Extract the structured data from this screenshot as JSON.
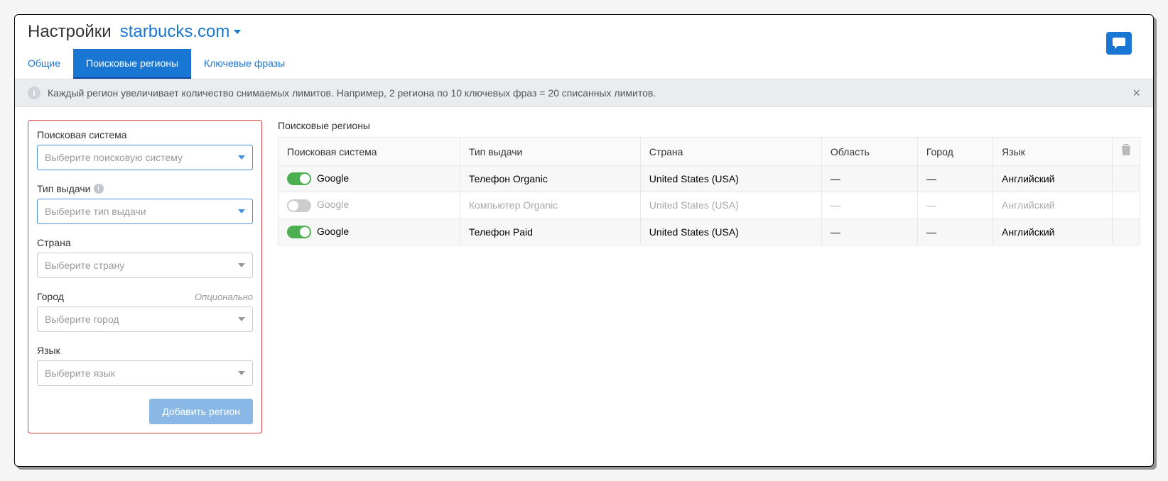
{
  "header": {
    "title": "Настройки",
    "domain": "starbucks.com"
  },
  "tabs": {
    "general": "Общие",
    "regions": "Поисковые регионы",
    "keywords": "Ключевые фразы"
  },
  "info": {
    "text": "Каждый регион увеличивает количество снимаемых лимитов. Например, 2 региона по 10 ключевых фраз = 20 списанных лимитов."
  },
  "form": {
    "search_system_label": "Поисковая система",
    "search_system_ph": "Выберите поисковую систему",
    "result_type_label": "Тип выдачи",
    "result_type_ph": "Выберите тип выдачи",
    "country_label": "Страна",
    "country_ph": "Выберите страну",
    "city_label": "Город",
    "city_optional": "Опционально",
    "city_ph": "Выберите город",
    "language_label": "Язык",
    "language_ph": "Выберите язык",
    "add_button": "Добавить регион"
  },
  "table": {
    "title": "Поисковые регионы",
    "columns": {
      "search_system": "Поисковая система",
      "result_type": "Тип выдачи",
      "country": "Страна",
      "region": "Область",
      "city": "Город",
      "language": "Язык"
    },
    "rows": [
      {
        "enabled": true,
        "search_system": "Google",
        "result_type": "Телефон Organic",
        "country": "United States (USA)",
        "region": "—",
        "city": "—",
        "language": "Английский"
      },
      {
        "enabled": false,
        "search_system": "Google",
        "result_type": "Компьютер Organic",
        "country": "United States (USA)",
        "region": "—",
        "city": "—",
        "language": "Английский"
      },
      {
        "enabled": true,
        "search_system": "Google",
        "result_type": "Телефон Paid",
        "country": "United States (USA)",
        "region": "—",
        "city": "—",
        "language": "Английский"
      }
    ]
  }
}
